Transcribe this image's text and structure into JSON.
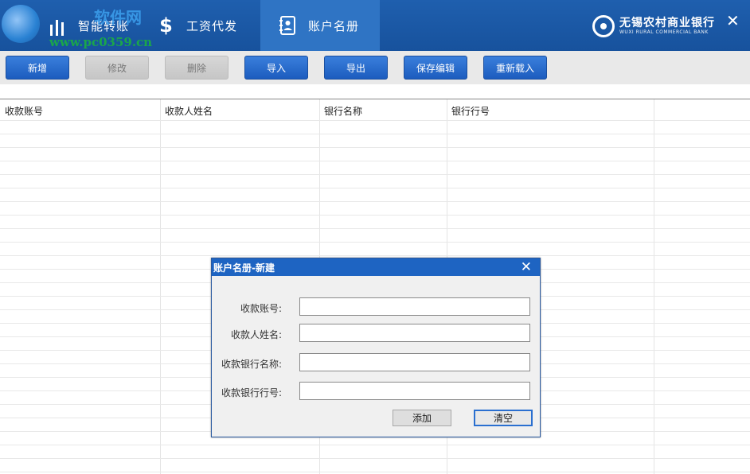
{
  "header": {
    "tabs": [
      {
        "label": "智能转账",
        "icon": "chart-bars-icon"
      },
      {
        "label": "工资代发",
        "icon": "dollar-icon"
      },
      {
        "label": "账户名册",
        "icon": "contact-book-icon"
      }
    ],
    "active_tab": 2,
    "bank_name_cn": "无锡农村商业银行",
    "bank_name_en": "WUXI RURAL COMMERCIAL BANK",
    "watermark_url": "www.pc0359.cn",
    "watermark_text": "软件网",
    "close_icon": "close-icon"
  },
  "toolbar": {
    "buttons": [
      {
        "label": "新增",
        "enabled": true
      },
      {
        "label": "修改",
        "enabled": false
      },
      {
        "label": "删除",
        "enabled": false
      },
      {
        "label": "导入",
        "enabled": true
      },
      {
        "label": "导出",
        "enabled": true
      },
      {
        "label": "保存编辑",
        "enabled": true
      },
      {
        "label": "重新载入",
        "enabled": true
      }
    ]
  },
  "table": {
    "columns": [
      "收款账号",
      "收款人姓名",
      "银行名称",
      "银行行号"
    ],
    "rows": []
  },
  "dialog": {
    "title": "账户名册-新建",
    "fields": [
      {
        "label": "收款账号:",
        "value": ""
      },
      {
        "label": "收款人姓名:",
        "value": ""
      },
      {
        "label": "收款银行名称:",
        "value": ""
      },
      {
        "label": "收款银行行号:",
        "value": ""
      }
    ],
    "add_label": "添加",
    "clear_label": "清空"
  },
  "colors": {
    "header_bg": "#1f5fae",
    "active_tab_bg": "#2f74c4",
    "button_blue": "#1c5cbe",
    "button_disabled": "#c6c6c6",
    "dialog_title_bg": "#1e64c2"
  }
}
